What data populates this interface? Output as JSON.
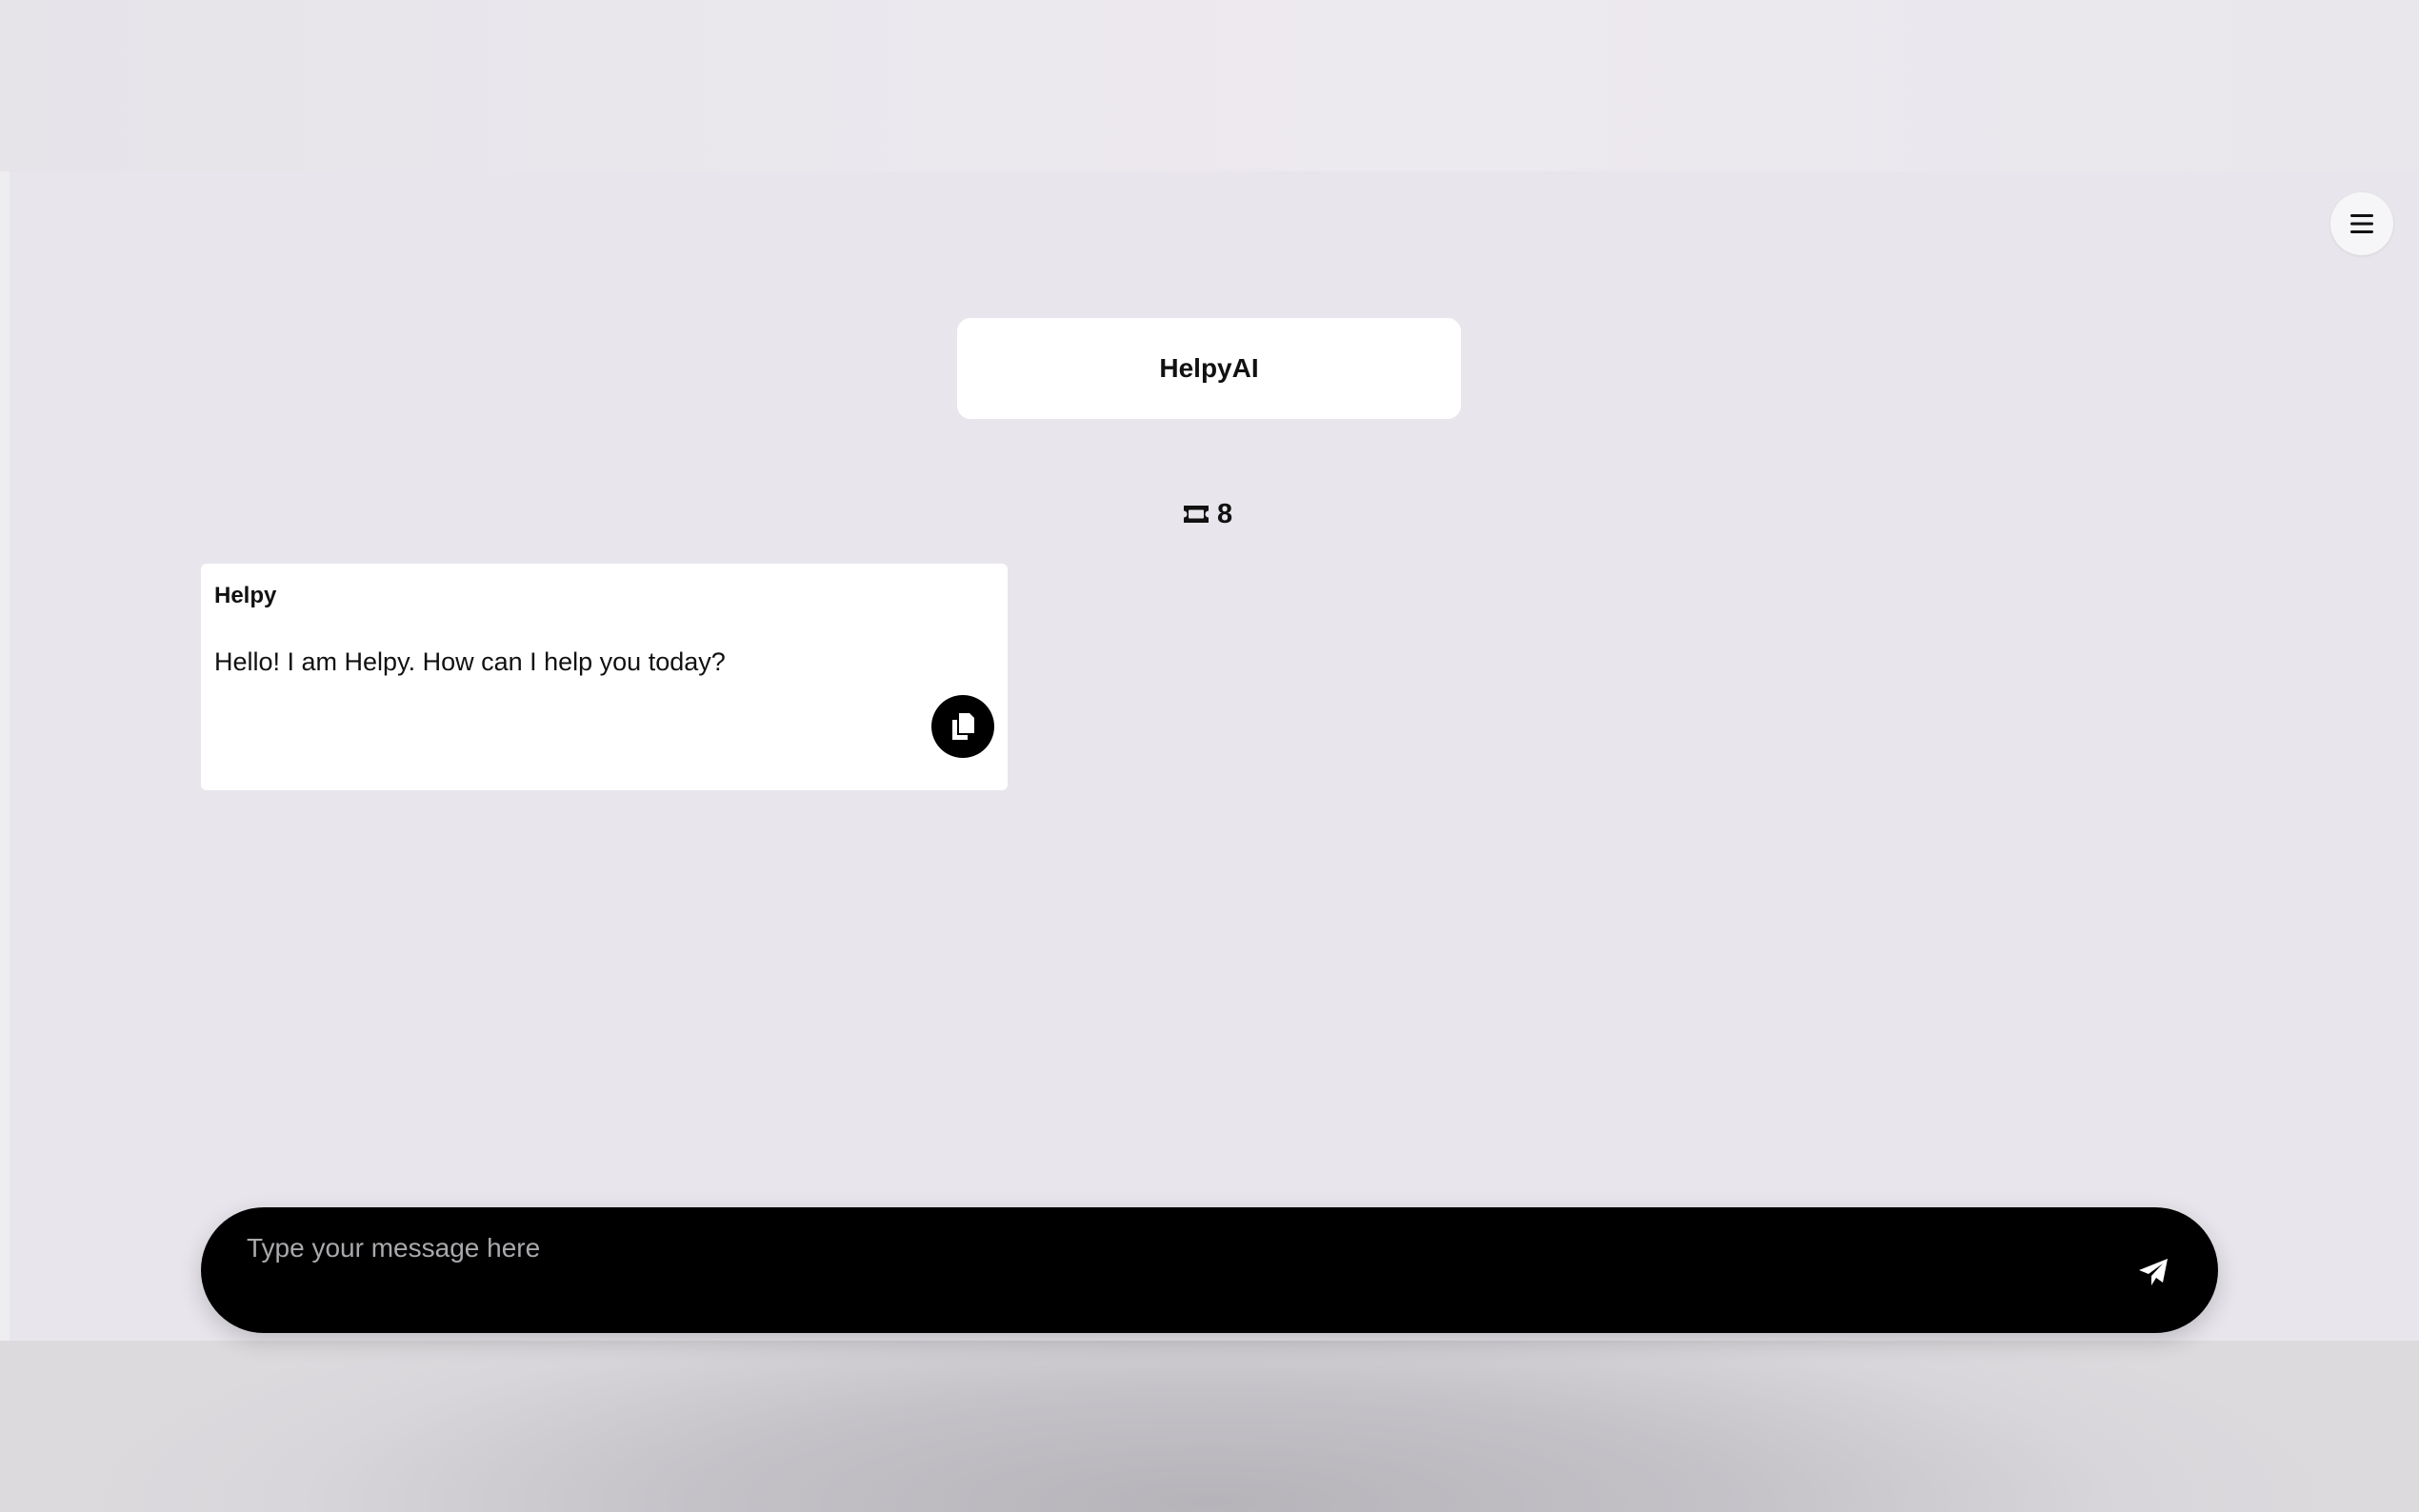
{
  "header": {
    "title": "HelpyAI",
    "menu_icon": "hamburger-menu-icon"
  },
  "tokens": {
    "icon": "ticket-icon",
    "count": "8"
  },
  "messages": [
    {
      "sender": "Helpy",
      "text": "Hello! I am Helpy. How can I help you today?",
      "copy_icon": "copy-icon"
    }
  ],
  "composer": {
    "placeholder": "Type your message here",
    "send_icon": "paper-plane-icon"
  },
  "colors": {
    "background": "#e8e6ec",
    "card": "#ffffff",
    "input_bar": "#000000",
    "text": "#111111",
    "placeholder": "#a9a9ad"
  }
}
